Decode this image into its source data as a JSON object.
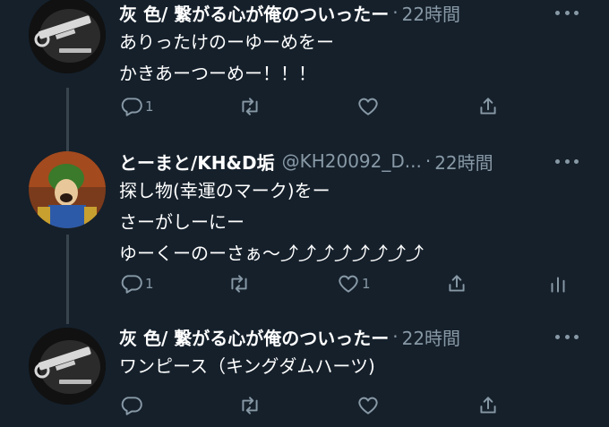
{
  "theme": {
    "background": "#15202b",
    "text": "#ffffff",
    "muted": "#8899a6",
    "thread_line": "#38444d"
  },
  "tweets": [
    {
      "name": "灰 色/ 繋がる心が俺のついったー",
      "handle": "",
      "separator": "·",
      "time": "22時間",
      "lines": [
        "ありったけのーゆーめをー",
        "かきあーつーめー！！！"
      ],
      "reply_count": "1",
      "retweet_count": "",
      "like_count": "",
      "avatar_icon": "keyblade-keychain-avatar"
    },
    {
      "name": "とーまと/KH&D垢",
      "handle": "@KH20092_D...",
      "separator": "·",
      "time": "22時間",
      "lines": [
        "探し物(幸運のマーク)をー",
        "さーがしーにー",
        "ゆーくーのーさぁ〜⤴︎⤴︎⤴︎⤴︎⤴︎⤴︎⤴︎⤴︎"
      ],
      "reply_count": "1",
      "retweet_count": "",
      "like_count": "1",
      "avatar_icon": "goofy-avatar"
    },
    {
      "name": "灰 色/ 繋がる心が俺のついったー",
      "handle": "",
      "separator": "·",
      "time": "22時間",
      "lines": [
        "ワンピース（キングダムハーツ)"
      ],
      "reply_count": "",
      "retweet_count": "",
      "like_count": "",
      "avatar_icon": "keyblade-keychain-avatar"
    }
  ]
}
